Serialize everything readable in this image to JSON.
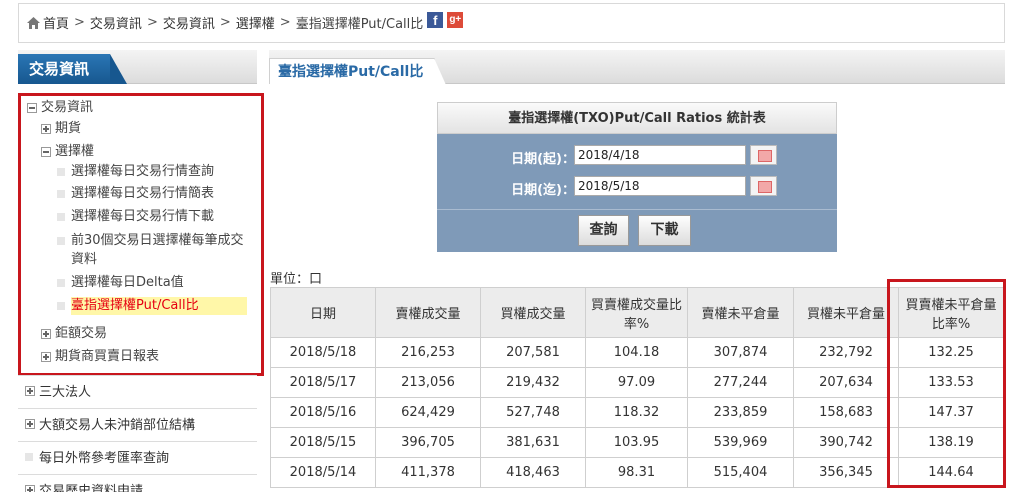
{
  "breadcrumb": {
    "items": [
      "首頁",
      "交易資訊",
      "交易資訊",
      "選擇權",
      "臺指選擇權Put/Call比"
    ],
    "separator": ">",
    "social": {
      "facebook": "f",
      "googleplus": "g+"
    }
  },
  "sidebar": {
    "header": "交易資訊",
    "tree": {
      "root": "交易資訊",
      "futures": "期貨",
      "options": "選擇權",
      "option_items": [
        "選擇權每日交易行情查詢",
        "選擇權每日交易行情簡表",
        "選擇權每日交易行情下載",
        "前30個交易日選擇權每筆成交",
        "資料",
        "選擇權每日Delta值",
        "臺指選擇權Put/Call比"
      ],
      "block_trade": "鉅額交易",
      "daily_report": "期貨商買賣日報表"
    },
    "sections": [
      "三大法人",
      "大額交易人未沖銷部位結構",
      "每日外幣參考匯率查詢",
      "交易歷史資料申請"
    ]
  },
  "main": {
    "tab_title": "臺指選擇權Put/Call比",
    "query": {
      "title": "臺指選擇權(TXO)Put/Call Ratios 統計表",
      "start_label": "日期(起)：",
      "start_value": "2018/4/18",
      "end_label": "日期(迄)：",
      "end_value": "2018/5/18",
      "search_button": "查詢",
      "download_button": "下載"
    },
    "unit_label": "單位：口",
    "table": {
      "headers": [
        "日期",
        "賣權成交量",
        "買權成交量",
        "買賣權成交量比率%",
        "賣權未平倉量",
        "買權未平倉量",
        "買賣權未平倉量比率%"
      ],
      "rows": [
        [
          "2018/5/18",
          "216,253",
          "207,581",
          "104.18",
          "307,874",
          "232,792",
          "132.25"
        ],
        [
          "2018/5/17",
          "213,056",
          "219,432",
          "97.09",
          "277,244",
          "207,634",
          "133.53"
        ],
        [
          "2018/5/16",
          "624,429",
          "527,748",
          "118.32",
          "233,859",
          "158,683",
          "147.37"
        ],
        [
          "2018/5/15",
          "396,705",
          "381,631",
          "103.95",
          "539,969",
          "390,742",
          "138.19"
        ],
        [
          "2018/5/14",
          "411,378",
          "418,463",
          "98.31",
          "515,404",
          "356,345",
          "144.64"
        ]
      ]
    }
  },
  "colors": {
    "highlight_border": "#c8161d",
    "sidebar_tab": "#1f66a3",
    "query_panel": "#7f9ab8",
    "active_item_bg": "#fff7a8",
    "active_item_text": "#e60012"
  }
}
